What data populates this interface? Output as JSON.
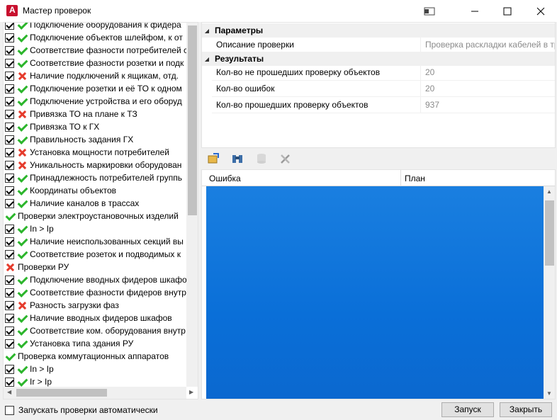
{
  "window": {
    "title": "Мастер проверок"
  },
  "tree": {
    "rows": [
      {
        "label": "Подключение оборудования к фидера",
        "checkbox": true,
        "status": "ok",
        "indent": 1
      },
      {
        "label": "Подключение объектов шлейфом, к от",
        "checkbox": true,
        "status": "ok",
        "indent": 1
      },
      {
        "label": "Соответствие фазности потребителей с",
        "checkbox": true,
        "status": "ok",
        "indent": 1
      },
      {
        "label": "Соответствие фазности розетки и подк",
        "checkbox": true,
        "status": "ok",
        "indent": 1
      },
      {
        "label": "Наличие подключений к ящикам, отд.",
        "checkbox": true,
        "status": "err",
        "indent": 1
      },
      {
        "label": "Подключение розетки и её ТО к одном",
        "checkbox": true,
        "status": "ok",
        "indent": 1
      },
      {
        "label": "Подключение устройства и его оборуд",
        "checkbox": true,
        "status": "ok",
        "indent": 1
      },
      {
        "label": "Привязка ТО на плане к ТЗ",
        "checkbox": true,
        "status": "err",
        "indent": 1
      },
      {
        "label": "Привязка ТО к ГХ",
        "checkbox": true,
        "status": "ok",
        "indent": 1
      },
      {
        "label": "Правильность задания ГХ",
        "checkbox": true,
        "status": "ok",
        "indent": 1
      },
      {
        "label": "Установка мощности потребителей",
        "checkbox": true,
        "status": "err",
        "indent": 1
      },
      {
        "label": "Уникальность маркировки оборудован",
        "checkbox": true,
        "status": "err",
        "indent": 1
      },
      {
        "label": "Принадлежность потребителей группь",
        "checkbox": true,
        "status": "ok",
        "indent": 1
      },
      {
        "label": "Координаты объектов",
        "checkbox": true,
        "status": "ok",
        "indent": 1
      },
      {
        "label": "Наличие каналов в трассах",
        "checkbox": true,
        "status": "ok",
        "indent": 1
      },
      {
        "label": "Проверки электроустановочных изделий",
        "checkbox": false,
        "status": "ok",
        "indent": 0
      },
      {
        "label": "In > Ip",
        "checkbox": true,
        "status": "ok",
        "indent": 1
      },
      {
        "label": "Наличие неиспользованных секций вы",
        "checkbox": true,
        "status": "ok",
        "indent": 1
      },
      {
        "label": "Соответствие розеток и подводимых к",
        "checkbox": true,
        "status": "ok",
        "indent": 1
      },
      {
        "label": "Проверки РУ",
        "checkbox": false,
        "status": "err",
        "indent": 0
      },
      {
        "label": "Подключение вводных фидеров шкафо",
        "checkbox": true,
        "status": "ok",
        "indent": 1
      },
      {
        "label": "Соответствие фазности фидеров внутр",
        "checkbox": true,
        "status": "ok",
        "indent": 1
      },
      {
        "label": "Разность загрузки фаз",
        "checkbox": true,
        "status": "err",
        "indent": 1
      },
      {
        "label": "Наличие вводных фидеров шкафов",
        "checkbox": true,
        "status": "ok",
        "indent": 1
      },
      {
        "label": "Соответствие ком. оборудования внутр",
        "checkbox": true,
        "status": "ok",
        "indent": 1
      },
      {
        "label": "Установка типа здания РУ",
        "checkbox": true,
        "status": "ok",
        "indent": 1
      },
      {
        "label": "Проверка коммутационных аппаратов",
        "checkbox": false,
        "status": "ok",
        "indent": 0
      },
      {
        "label": "In > Ip",
        "checkbox": true,
        "status": "ok",
        "indent": 1
      },
      {
        "label": "Ir > Ip",
        "checkbox": true,
        "status": "ok",
        "indent": 1
      }
    ]
  },
  "properties": {
    "params_title": "Параметры",
    "desc_label": "Описание проверки",
    "desc_value": "Проверка раскладки кабелей в тр",
    "results_title": "Результаты",
    "failed_label": "Кол-во не прошедших проверку объектов",
    "failed_value": "20",
    "errors_label": "Кол-во ошибок",
    "errors_value": "20",
    "passed_label": "Кол-во прошедших проверку объектов",
    "passed_value": "937"
  },
  "toolbar": {
    "icons": [
      "export-icon",
      "binoculars-icon",
      "database-icon",
      "tools-icon"
    ]
  },
  "grid": {
    "col_error": "Ошибка",
    "col_plan": "План"
  },
  "footer": {
    "auto_run_label": "Запускать проверки автоматически",
    "auto_run_checked": false,
    "run_button": "Запуск",
    "close_button": "Закрыть"
  }
}
